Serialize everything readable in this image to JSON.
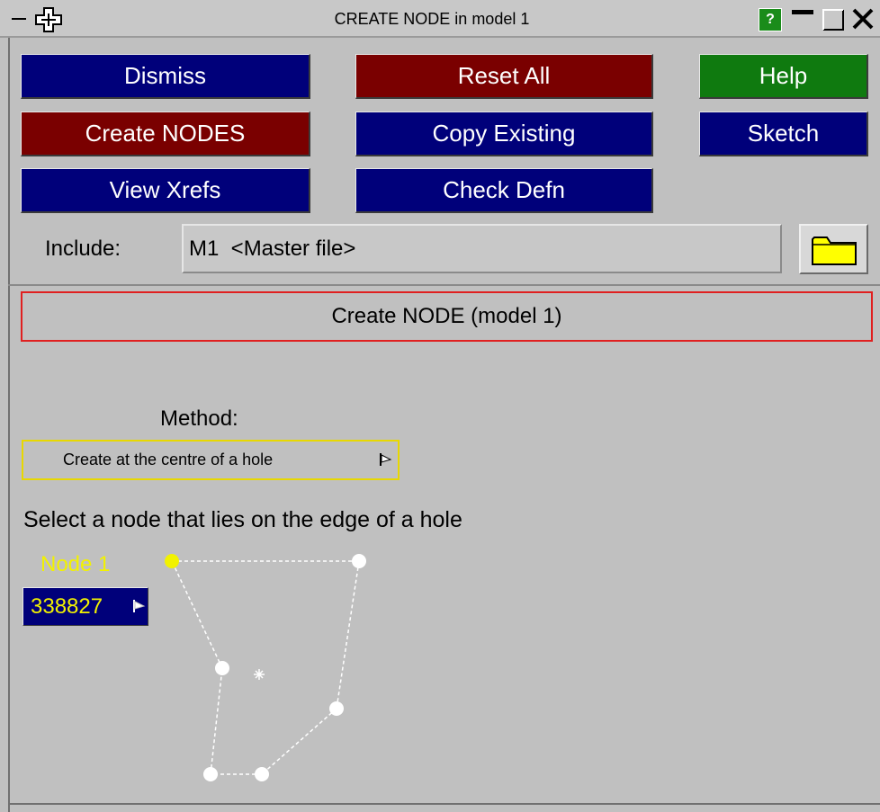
{
  "window": {
    "title": "CREATE NODE in model 1",
    "help_glyph": "?"
  },
  "buttons": {
    "dismiss": "Dismiss",
    "reset_all": "Reset All",
    "help": "Help",
    "create_nodes": "Create NODES",
    "copy_existing": "Copy Existing",
    "sketch": "Sketch",
    "view_xrefs": "View Xrefs",
    "check_defn": "Check Defn"
  },
  "include": {
    "label": "Include:",
    "value": "M1  <Master file>"
  },
  "panel": {
    "title": "Create NODE (model 1)"
  },
  "method": {
    "label": "Method:",
    "selected": "Create at the centre of a hole"
  },
  "instruction": "Select a node that lies on the edge of a hole",
  "node": {
    "label": "Node 1",
    "value": "338827"
  },
  "colors": {
    "button_blue": "#00007a",
    "button_red": "#7a0000",
    "button_green": "#0f7a0f",
    "panel_bg": "#c0c0c0",
    "highlight_yellow": "#f2f200",
    "panel_border_red": "#e02020"
  },
  "icons": [
    "move-cross-icon",
    "help-icon",
    "minimize-icon",
    "maximize-icon",
    "close-icon",
    "folder-icon",
    "dropdown-flag-icon"
  ]
}
